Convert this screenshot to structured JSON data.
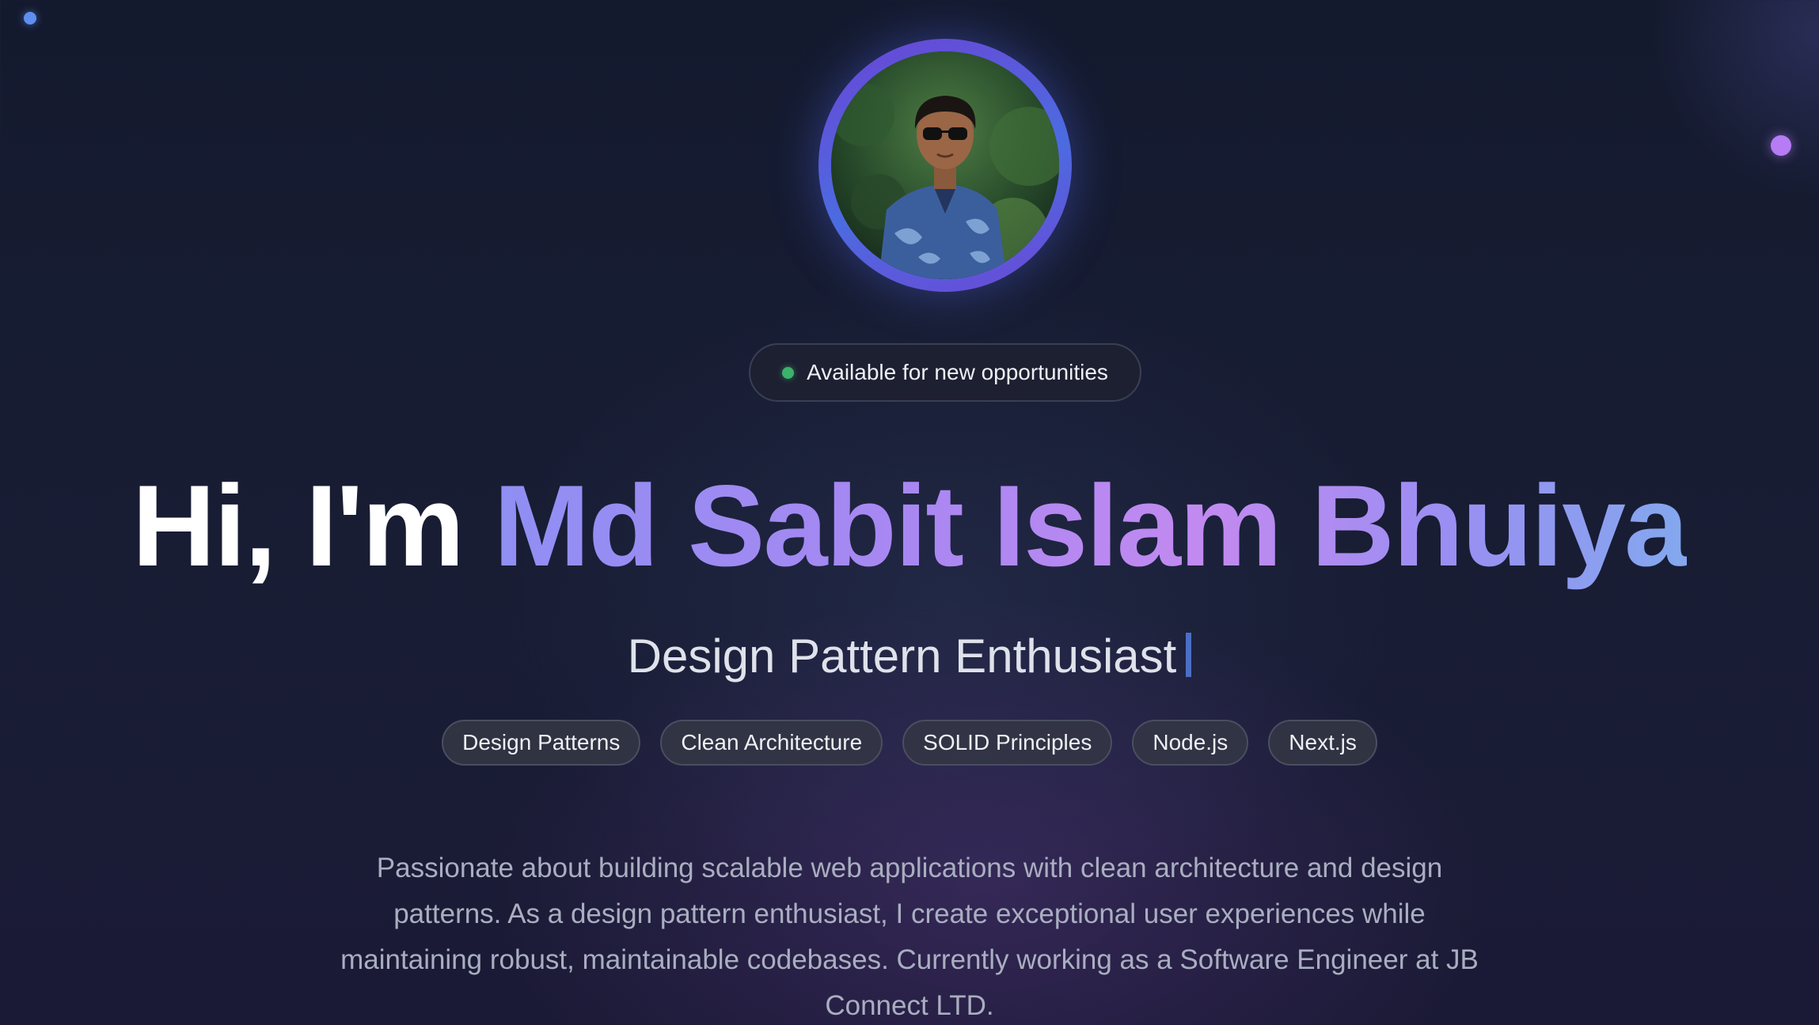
{
  "hero": {
    "avatar_alt": "Profile photo of Md Sabit Islam Bhuiya",
    "status": "Available for new opportunities",
    "greeting": "Hi, I'm",
    "name": "Md Sabit Islam Bhuiya",
    "role": "Design Pattern Enthusiast",
    "tags": [
      "Design Patterns",
      "Clean Architecture",
      "SOLID Principles",
      "Node.js",
      "Next.js"
    ],
    "bio": "Passionate about building scalable web applications with clean architecture and design patterns. As a design pattern enthusiast, I create exceptional user experiences while maintaining robust, maintainable codebases. Currently working as a Software Engineer at JB Connect LTD."
  },
  "colors": {
    "background": "#141a2e",
    "status_dot": "#3bb36a",
    "name_gradient_start": "#8f8ff3",
    "name_gradient_mid": "#c28af0",
    "name_gradient_end": "#83a8ee",
    "caret": "#4a6fc6",
    "accent_dot_blue": "#5f8ef0",
    "accent_dot_purple": "#b57cf5"
  }
}
